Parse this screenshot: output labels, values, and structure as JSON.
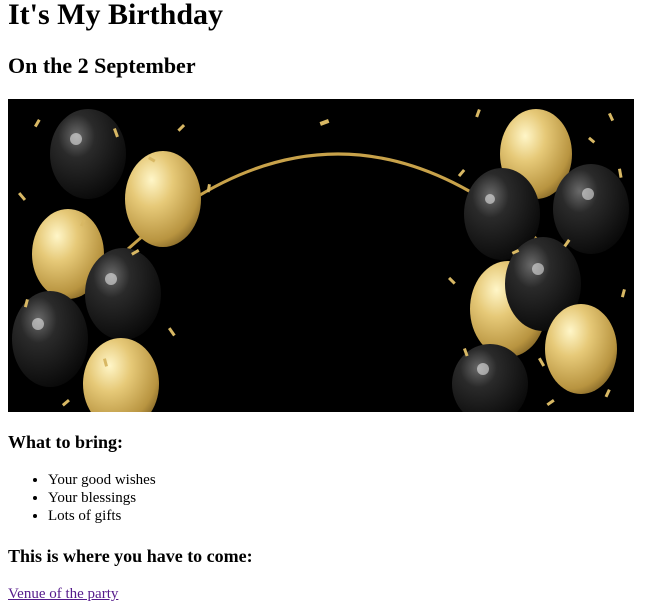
{
  "page": {
    "title": "It's My Birthday",
    "subtitle": "On the 2 September",
    "banner_image": {
      "description_icon": "birthday-balloons-image",
      "colors": {
        "background": "#000000",
        "gold": "#d8b864",
        "black_balloon": "#1a1a1a",
        "arch": "#c8a24a"
      }
    },
    "bring": {
      "heading": "What to bring:",
      "items": [
        "Your good wishes",
        "Your blessings",
        "Lots of gifts"
      ]
    },
    "venue": {
      "heading": "This is where you have to come:",
      "link_text": "Venue of the party"
    }
  }
}
